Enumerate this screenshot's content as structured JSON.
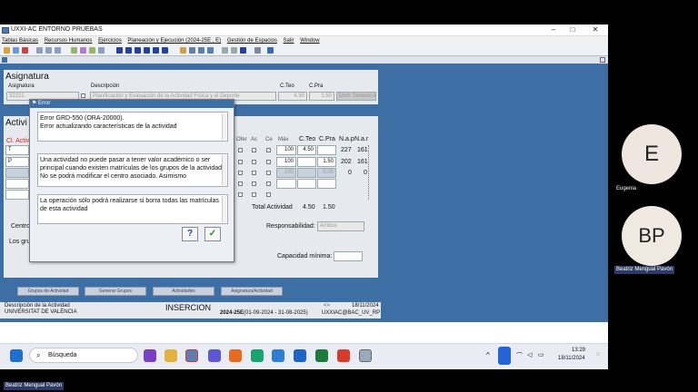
{
  "window": {
    "title": "UXXI-AC ENTORNO PRUEBAS"
  },
  "menu": [
    "Tablas Básicas",
    "Recursos Humanos",
    "Ejercicios",
    "Planeación y Ejecución  (2024-25E , E)",
    "Gestión de Espacios",
    "Salir",
    "Window"
  ],
  "asignatura": {
    "heading": "Asignatura",
    "col_asig": "Asignatura",
    "col_desc": "Descripción",
    "col_cteo": "C.Teo",
    "col_cpra": "C.Pra",
    "code": "32221",
    "description": "Planificación y Evaluación de la Actividad Física y el Deporte",
    "cteo": "4.50",
    "cpra": "1.50",
    "extra": "Mod. Semestral"
  },
  "actividades": {
    "heading": "Activi",
    "col_cl": "Cl. Activ",
    "row_codes": [
      "T",
      "P",
      ""
    ],
    "flag_headers": [
      "Ofer",
      "Ac",
      "Ce"
    ],
    "col_max": "Máx",
    "col_cteo": "C.Teo",
    "col_cpra": "C.Pra",
    "col_nap": "N.a.p",
    "col_nar": "N.a.r",
    "rows": [
      {
        "max": "100",
        "cteo": "4.50",
        "cpra": "",
        "nap": "227",
        "nar": "161"
      },
      {
        "max": "100",
        "cteo": "",
        "cpra": "1.50",
        "nap": "202",
        "nar": "161"
      },
      {
        "max": "100",
        "cteo": "",
        "cpra": "0.00",
        "nap": "0",
        "nar": "0"
      }
    ],
    "total_label": "Total Actividad",
    "total_cteo": "4.50",
    "total_cpra": "1.50",
    "centro_label": "Centro",
    "grupos_label": "Los gru",
    "responsabilidad_label": "Responsabilidad:",
    "responsabilidad_value": "Ambos",
    "capacidad_label": "Capacidad mínima:",
    "capacidad_value": ""
  },
  "bottom_buttons": [
    "Grupos de Actividad",
    "Generar Grupos",
    "Actividades",
    "Asignatura/Actividad"
  ],
  "status": {
    "desc_label": "Descripción de la Actividad",
    "org": "UNIVERSITAT DE VALÈNCIA",
    "mode": "INSERCION",
    "date": "18/11/2024",
    "year": "2024-25E",
    "range": "(01-09-2024 - 31-08-2025)",
    "conn": "UXXIAC@BAC_UV_RP",
    "markers": "<>"
  },
  "dialog": {
    "title": "Error",
    "msg1_line1": "Error GRD-550 (ORA-20000).",
    "msg1_line2": "Error actualizando características de la actividad",
    "msg2": "Una actividad no puede pasar a tener valor académico o ser principal cuando existen matrículas de los grupos de la actividad. No se podrá modificar el centro asociado. Asimismo",
    "msg3": "La operación sólo podrá realizarse si borra todas las matrículas de esta actividad",
    "help_label": "?",
    "ok_label": "✓"
  },
  "taskbar": {
    "search_placeholder": "Búsqueda",
    "time": "13:29",
    "date": "18/11/2024"
  },
  "participants": [
    {
      "initials": "E",
      "name": "Eugenia"
    },
    {
      "initials": "BP",
      "name": "Beatriz Mengual Pavón"
    }
  ],
  "presenter": "Beatriz Mengual Pavón"
}
